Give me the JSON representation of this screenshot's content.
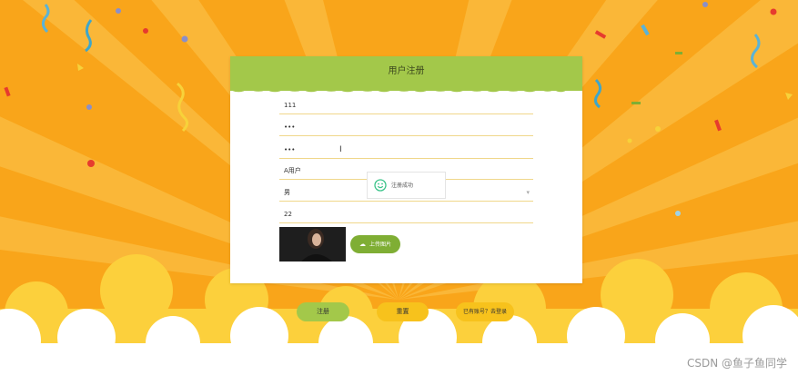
{
  "form": {
    "title": "用户注册",
    "fields": [
      "111",
      "•••",
      "•••",
      "A用户",
      "男",
      "22"
    ],
    "upload_label": "上传图片"
  },
  "toast": {
    "message": "注册成功"
  },
  "buttons": {
    "register": "注册",
    "reset": "重置",
    "login": "已有账号？去登录"
  },
  "watermark": "CSDN @鱼子鱼同学",
  "colors": {
    "background": "#f9a51a",
    "card_header": "#a3c84a",
    "accent_green": "#7fae34",
    "accent_yellow": "#f7c21c"
  }
}
